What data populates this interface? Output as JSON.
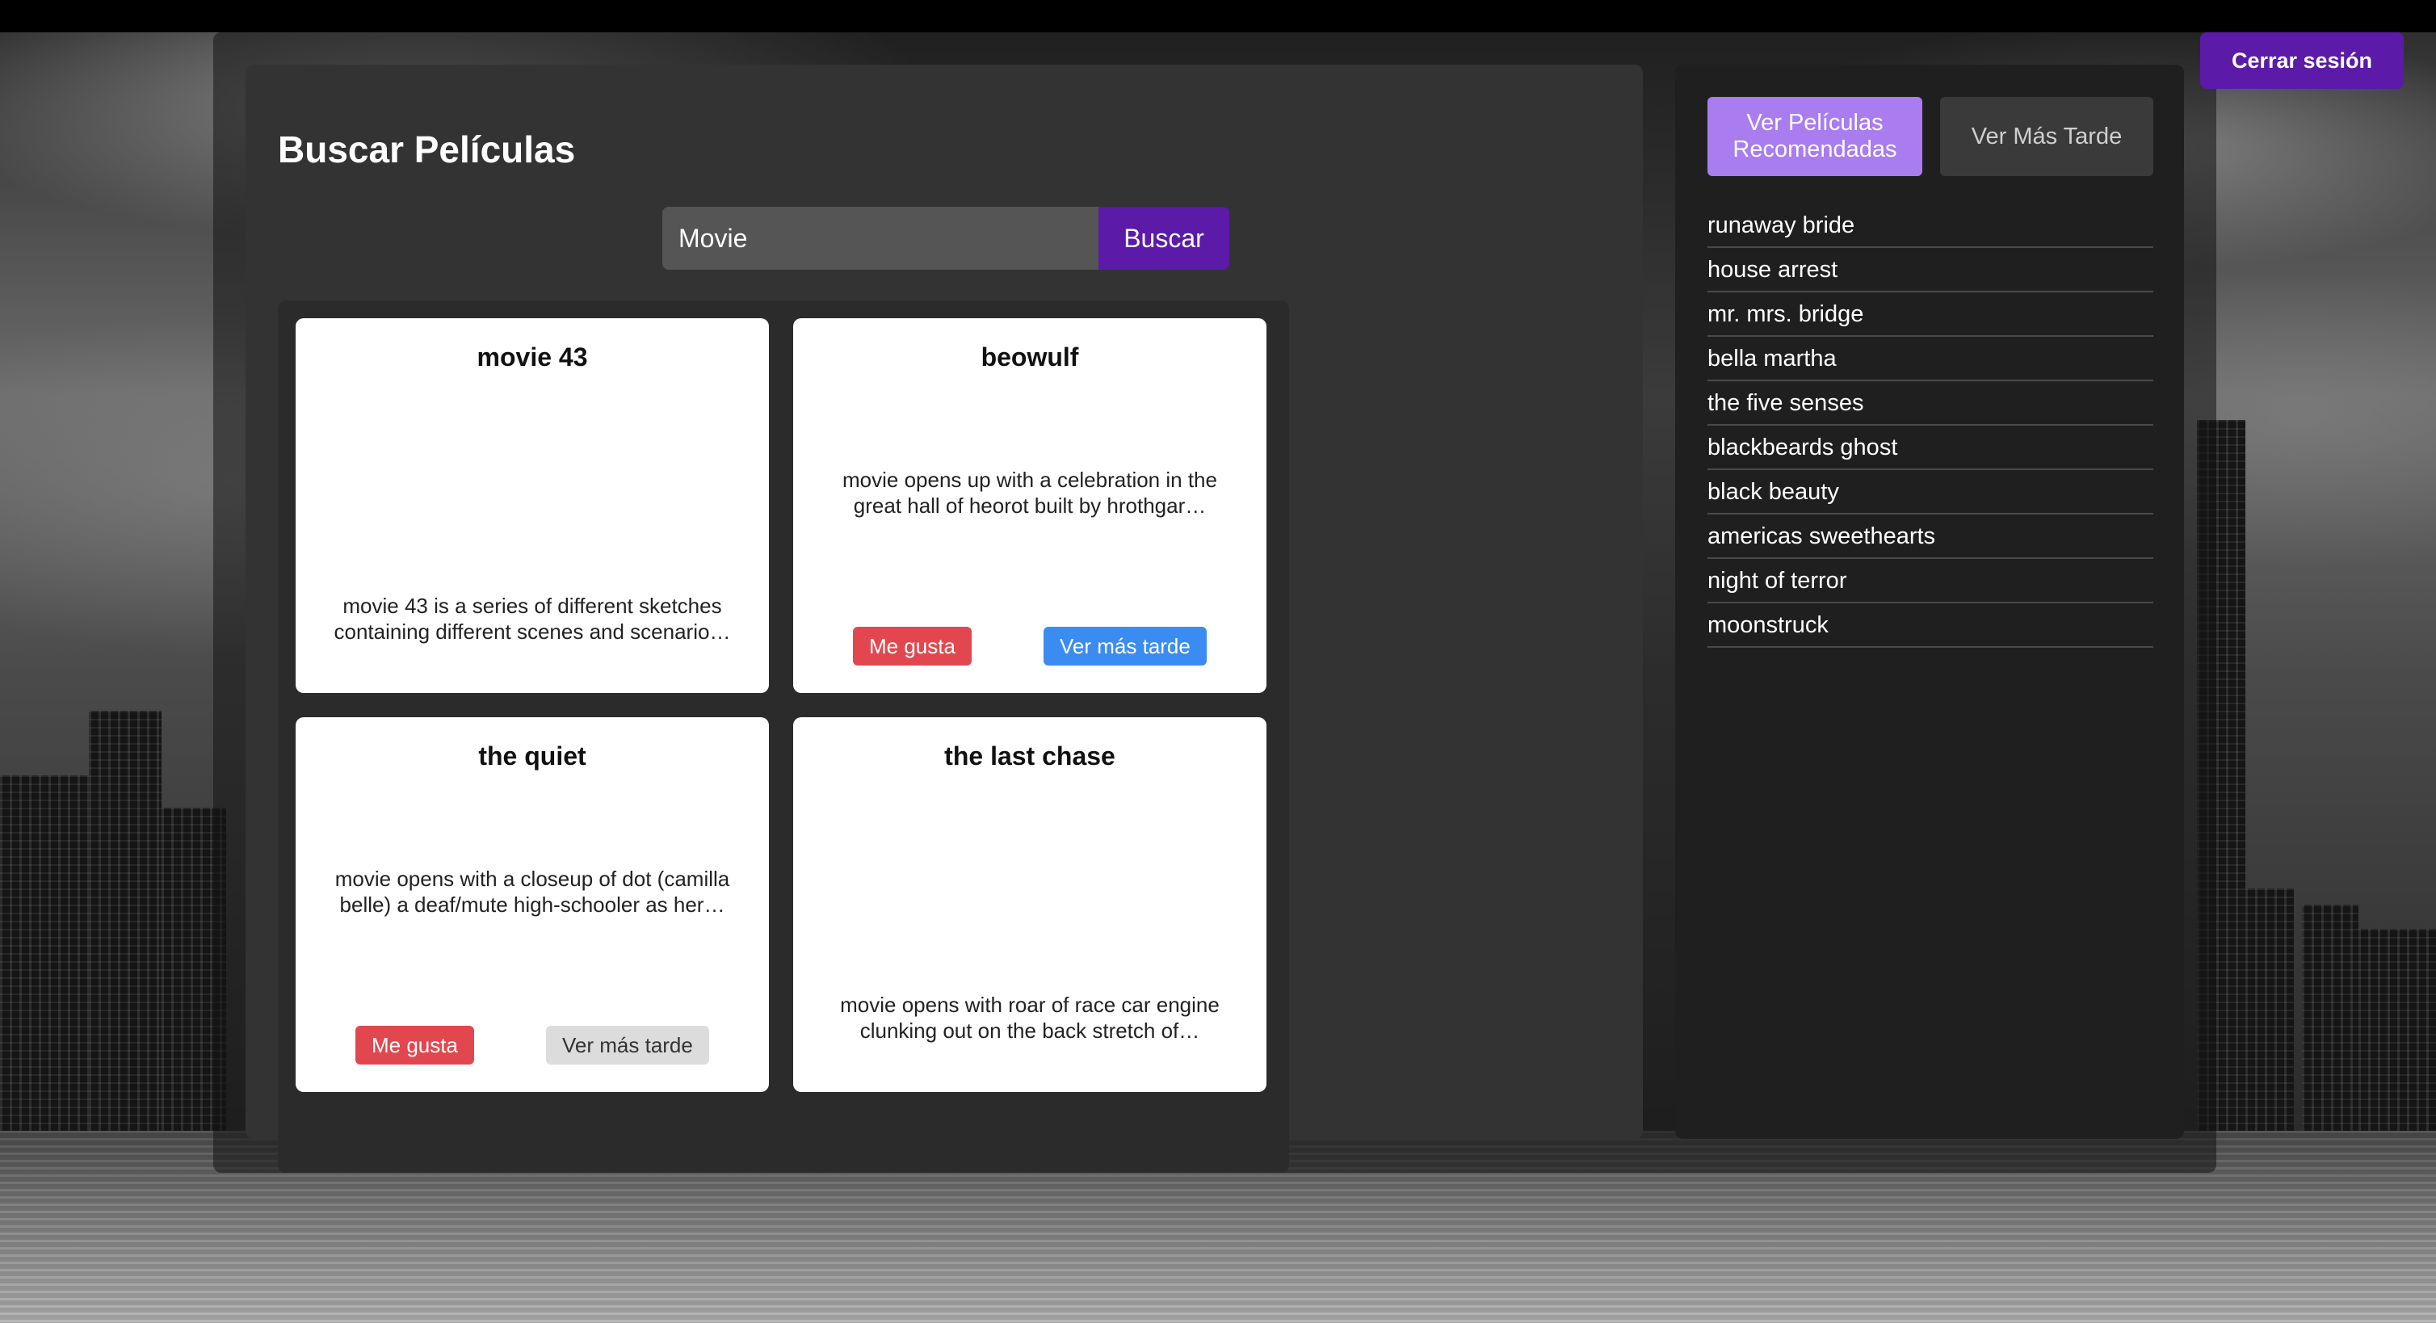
{
  "header": {
    "logout_label": "Cerrar sesión"
  },
  "main": {
    "title": "Buscar Películas",
    "search": {
      "value": "Movie",
      "button_label": "Buscar"
    },
    "cards": [
      {
        "title": "movie 43",
        "description": "movie 43 is a series of different sketches containing different scenes and scenario…"
      },
      {
        "title": "beowulf",
        "description": "movie opens up with a celebration in the great hall of heorot built by hrothgar…",
        "like_label": "Me gusta",
        "later_label": "Ver más tarde"
      },
      {
        "title": "the quiet",
        "description": "movie opens with a closeup of dot (camilla belle) a deaf/mute high-schooler as her…",
        "like_label": "Me gusta",
        "later_label": "Ver más tarde"
      },
      {
        "title": "the last chase",
        "description": "movie opens with roar of race car engine clunking out on the back stretch of…"
      }
    ]
  },
  "sidebar": {
    "tab_recommended": "Ver Películas Recomendadas",
    "tab_watch_later": "Ver Más Tarde",
    "items": [
      "runaway bride",
      "house arrest",
      "mr. mrs. bridge",
      "bella martha",
      "the five senses",
      "blackbeards ghost",
      "black beauty",
      "americas sweethearts",
      "night of terror",
      "moonstruck"
    ]
  },
  "colors": {
    "accent_purple": "#5b1aa8",
    "tab_active": "#a97cf0",
    "like_red": "#e2474f",
    "later_blue": "#3b8cf0"
  }
}
